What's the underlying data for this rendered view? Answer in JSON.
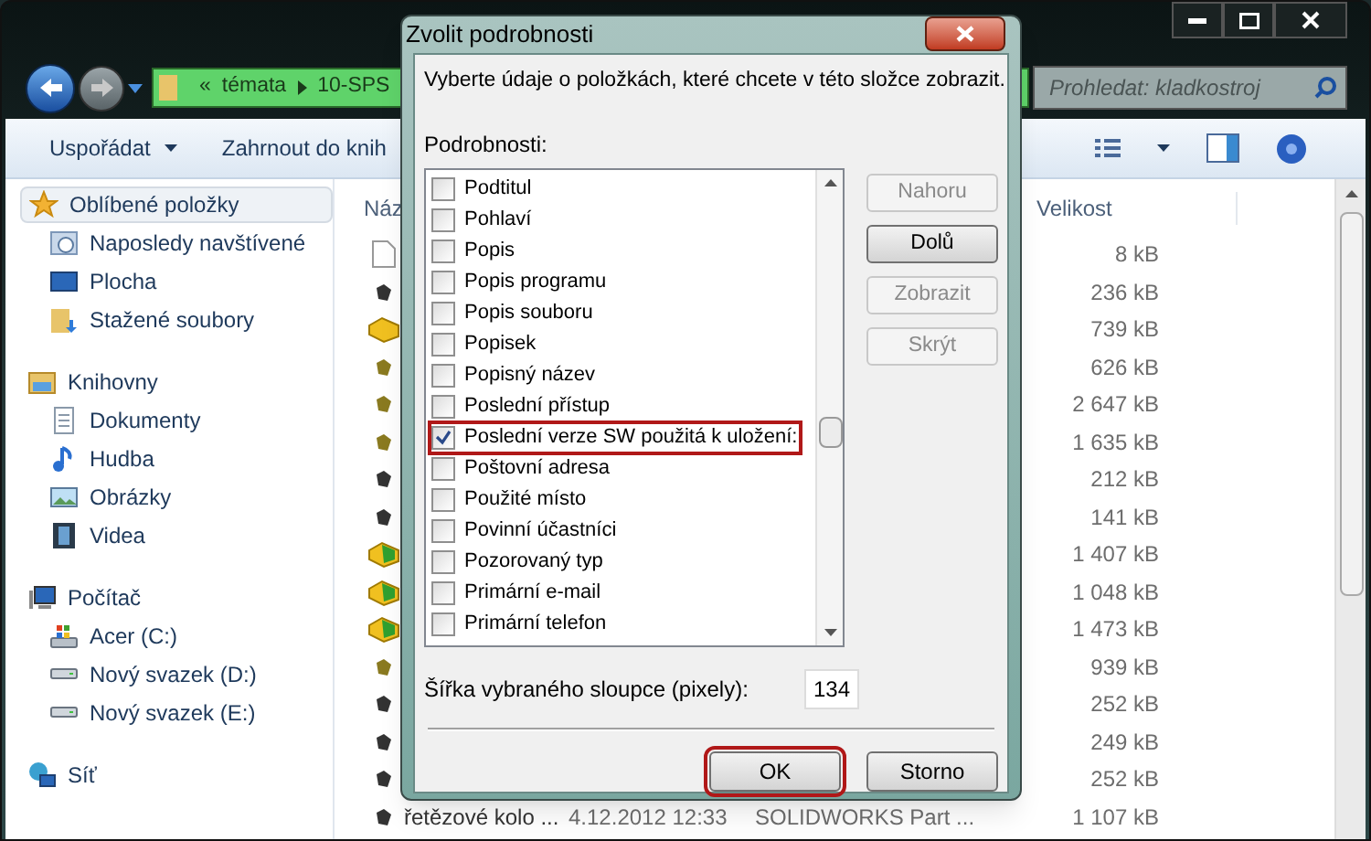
{
  "window": {
    "nav": {
      "address": [
        "«",
        "témata",
        "10-SPS"
      ],
      "search": {
        "placeholder": "Prohledat: kladkostroj"
      }
    },
    "toolbar": {
      "items": [
        "Uspořádat",
        "Zahrnout do knih"
      ]
    },
    "sidebar": {
      "groups": [
        {
          "label": "Oblíbené položky",
          "kind": "star",
          "selected": true,
          "children": [
            {
              "label": "Naposledy navštívené",
              "kind": "recent"
            },
            {
              "label": "Plocha",
              "kind": "desktop"
            },
            {
              "label": "Stažené soubory",
              "kind": "download"
            }
          ]
        },
        {
          "label": "Knihovny",
          "kind": "library",
          "selected": false,
          "children": [
            {
              "label": "Dokumenty",
              "kind": "doc"
            },
            {
              "label": "Hudba",
              "kind": "music"
            },
            {
              "label": "Obrázky",
              "kind": "picture"
            },
            {
              "label": "Videa",
              "kind": "video"
            }
          ]
        },
        {
          "label": "Počítač",
          "kind": "computer",
          "selected": false,
          "children": [
            {
              "label": "Acer (C:)",
              "kind": "system-drive"
            },
            {
              "label": "Nový svazek (D:)",
              "kind": "drive"
            },
            {
              "label": "Nový svazek (E:)",
              "kind": "drive"
            }
          ]
        },
        {
          "label": "Síť",
          "kind": "network",
          "selected": false
        }
      ]
    },
    "table": {
      "columns": [
        "Náz",
        "Velikost"
      ],
      "rows": [
        {
          "kind": "blank",
          "size": "8 kB"
        },
        {
          "kind": "tool",
          "size": "236 kB"
        },
        {
          "kind": "assembly",
          "size": "739 kB"
        },
        {
          "kind": "part",
          "size": "626 kB"
        },
        {
          "kind": "part",
          "size": "2 647 kB"
        },
        {
          "kind": "part",
          "size": "1 635 kB"
        },
        {
          "kind": "tool",
          "size": "212 kB"
        },
        {
          "kind": "tool",
          "size": "141 kB"
        },
        {
          "kind": "assembly-green",
          "size": "1 407 kB"
        },
        {
          "kind": "assembly-green",
          "size": "1 048 kB"
        },
        {
          "kind": "assembly-green",
          "size": "1 473 kB"
        },
        {
          "kind": "part",
          "size": "939 kB"
        },
        {
          "kind": "tool",
          "size": "252 kB"
        },
        {
          "kind": "tool",
          "size": "249 kB"
        },
        {
          "kind": "tool",
          "size": "252 kB"
        },
        {
          "kind": "tool",
          "name": "řetězové kolo ...",
          "date": "4.12.2012 12:33",
          "type": "SOLIDWORKS Part ...",
          "size": "1 107 kB"
        }
      ]
    }
  },
  "dialog": {
    "title": "Zvolit podrobnosti",
    "intro": "Vyberte údaje o položkách, které chcete v této složce zobrazit.",
    "list_label": "Podrobnosti:",
    "items": [
      {
        "label": "Podtitul",
        "checked": false,
        "highlighted": false
      },
      {
        "label": "Pohlaví",
        "checked": false,
        "highlighted": false
      },
      {
        "label": "Popis",
        "checked": false,
        "highlighted": false
      },
      {
        "label": "Popis programu",
        "checked": false,
        "highlighted": false
      },
      {
        "label": "Popis souboru",
        "checked": false,
        "highlighted": false
      },
      {
        "label": "Popisek",
        "checked": false,
        "highlighted": false
      },
      {
        "label": "Popisný název",
        "checked": false,
        "highlighted": false
      },
      {
        "label": "Poslední přístup",
        "checked": false,
        "highlighted": false
      },
      {
        "label": "Poslední verze SW použitá k uložení:",
        "checked": true,
        "highlighted": true
      },
      {
        "label": "Poštovní adresa",
        "checked": false,
        "highlighted": false
      },
      {
        "label": "Použité místo",
        "checked": false,
        "highlighted": false
      },
      {
        "label": "Povinní účastníci",
        "checked": false,
        "highlighted": false
      },
      {
        "label": "Pozorovaný typ",
        "checked": false,
        "highlighted": false
      },
      {
        "label": "Primární e-mail",
        "checked": false,
        "highlighted": false
      },
      {
        "label": "Primární telefon",
        "checked": false,
        "highlighted": false
      }
    ],
    "side_buttons": [
      {
        "label": "Nahoru",
        "disabled": true
      },
      {
        "label": "Dolů",
        "disabled": false
      },
      {
        "label": "Zobrazit",
        "disabled": true
      },
      {
        "label": "Skrýt",
        "disabled": true
      }
    ],
    "width_label": "Šířka vybraného sloupce (pixely):",
    "width_value": "134",
    "buttons": [
      {
        "label": "OK",
        "highlighted": true
      },
      {
        "label": "Storno",
        "highlighted": false
      }
    ]
  }
}
